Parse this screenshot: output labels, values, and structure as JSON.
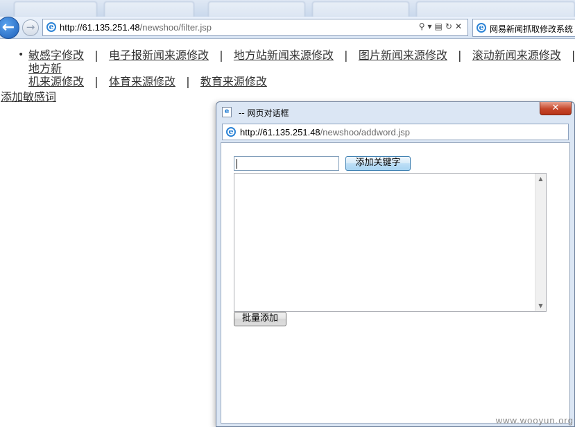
{
  "browser": {
    "address_host": "http://61.135.251.48",
    "address_path": "/newshoo/filter.jsp",
    "tab_title": "网易新闻抓取修改系统"
  },
  "nav": {
    "items": [
      "敏感字修改",
      "电子报新闻来源修改",
      "地方站新闻来源修改",
      "图片新闻来源修改",
      "滚动新闻来源修改",
      "地方新",
      "机来源修改",
      "体育来源修改",
      "教育来源修改"
    ],
    "separator": "|"
  },
  "add_sensitive_link": "添加敏感词",
  "dialog": {
    "title": "-- 网页对话框",
    "address_host": "http://61.135.251.48",
    "address_path": "/newshoo/addword.jsp",
    "keyword_input_value": "",
    "add_keyword_button": "添加关键字",
    "batch_add_button": "批量添加"
  },
  "icons": {
    "back": "back-arrow-icon",
    "forward": "forward-arrow-icon",
    "ie": "ie-icon",
    "close": "close-icon"
  },
  "watermark": "www.wooyun.org"
}
